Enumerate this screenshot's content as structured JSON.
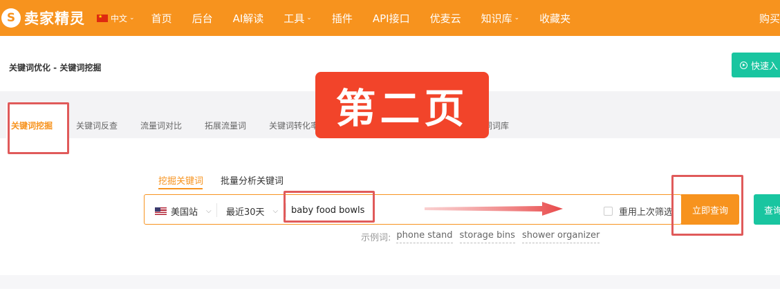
{
  "nav": {
    "logo_glyph": "S",
    "logo_text": "卖家精灵",
    "lang": "中文",
    "items": [
      "首页",
      "后台",
      "AI解读",
      "工具",
      "插件",
      "API接口",
      "优麦云",
      "知识库",
      "收藏夹"
    ],
    "right_text": "购买"
  },
  "breadcrumb": "关键词优化 - 关键词挖掘",
  "quick_button": "快速入",
  "tabs": [
    "关键词挖掘",
    "关键词反查",
    "流量词对比",
    "拓展流量词",
    "关键词转化率",
    "",
    "",
    "词词库"
  ],
  "overlay_badge": "第二页",
  "subtabs": [
    "挖掘关键词",
    "批量分析关键词"
  ],
  "search": {
    "site": "美国站",
    "period": "最近30天",
    "keyword": "baby food bowls",
    "reuse_label": "重用上次筛选",
    "query_button": "立即查询",
    "query2_button": "查询"
  },
  "examples": {
    "label": "示例词:",
    "items": [
      "phone stand",
      "storage bins",
      "shower organizer"
    ]
  },
  "colors": {
    "brand": "#f7931e",
    "teal": "#19c5a0",
    "annotation_red": "#e05a5a",
    "badge_red": "#f2442a"
  }
}
